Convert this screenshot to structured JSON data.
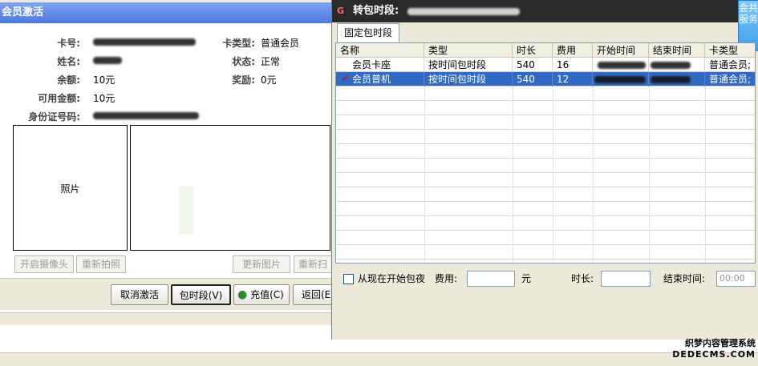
{
  "activation": {
    "title": "会员激活",
    "labels": {
      "card_no": "卡号:",
      "card_type": "卡类型:",
      "name": "姓名:",
      "status": "状态:",
      "balance": "余额:",
      "bonus": "奖励:",
      "available": "可用金额:",
      "id_no": "身份证号码:"
    },
    "values": {
      "card_type": "普通会员",
      "status": "正常",
      "balance": "10元",
      "bonus": "0元",
      "available": "10元"
    },
    "photo_label": "照片",
    "buttons": {
      "open_camera": "开启摄像头",
      "retake": "重新拍照",
      "update_image": "更新图片",
      "rescan": "重新扫",
      "cancel_activation": "取消激活",
      "package": "包时段(V)",
      "recharge": "充值(C)",
      "back": "返回(E"
    }
  },
  "package_window": {
    "title": "转包时段:",
    "side_tab": "会共服务",
    "tab_label": "固定包时段",
    "columns": [
      "名称",
      "类型",
      "时长",
      "费用",
      "开始时间",
      "结束时间",
      "卡类型"
    ],
    "rows": [
      {
        "name": "会员卡座",
        "type": "按时间包时段",
        "duration": "540",
        "fee": "16",
        "card_type": "普通会员;",
        "selected": false
      },
      {
        "name": "会员普机",
        "type": "按时间包时段",
        "duration": "540",
        "fee": "12",
        "card_type": "普通会员;",
        "selected": true
      }
    ],
    "options": {
      "start_now": "从现在开始包夜",
      "fee_label": "费用:",
      "fee_unit": "元",
      "duration_label": "时长:",
      "end_label": "结束时间:",
      "end_value": "00:00"
    }
  },
  "watermark": {
    "cn": "织梦内容管理系统",
    "en": "DEDECMS.COM"
  },
  "colors": {
    "title_blue": "#4f79e0",
    "selection": "#316ac5",
    "dialog_bg": "#ece9d8"
  }
}
